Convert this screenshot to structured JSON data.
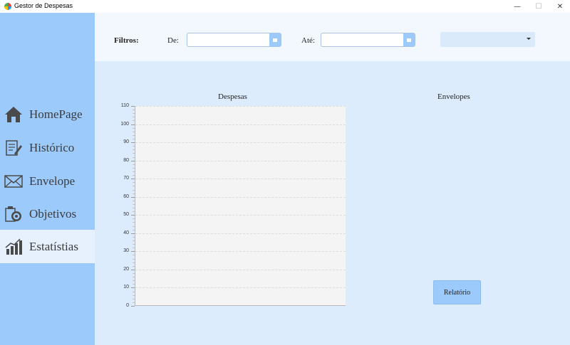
{
  "window": {
    "title": "Gestor de Despesas",
    "controls": {
      "minimize": "—",
      "maximize": "☐",
      "close": "✕"
    }
  },
  "sidebar": {
    "items": [
      {
        "label": "HomePage",
        "icon": "home-icon",
        "active": false
      },
      {
        "label": "Histórico",
        "icon": "history-icon",
        "active": false
      },
      {
        "label": "Envelope",
        "icon": "envelope-icon",
        "active": false
      },
      {
        "label": "Objetivos",
        "icon": "target-icon",
        "active": false
      },
      {
        "label": "Estatístias",
        "icon": "bar-chart-icon",
        "active": true
      }
    ]
  },
  "filters": {
    "title": "Filtros:",
    "from_label": "De:",
    "from_value": "",
    "to_label": "Até:",
    "to_value": "",
    "category_value": ""
  },
  "chart_data": [
    {
      "type": "bar",
      "title": "Despesas",
      "categories": [],
      "values": [],
      "ylim": [
        0,
        110
      ],
      "yticks": [
        0,
        10,
        20,
        30,
        40,
        50,
        60,
        70,
        80,
        90,
        100,
        110
      ],
      "grid": true
    },
    {
      "type": "pie",
      "title": "Envelopes",
      "labels": [],
      "values": []
    }
  ],
  "report": {
    "label": "Relatório"
  },
  "colors": {
    "sidebar": "#9ccafb",
    "active_item": "#e6f1fd",
    "content_bg": "#dcecfd",
    "accent": "#9ccafb"
  }
}
